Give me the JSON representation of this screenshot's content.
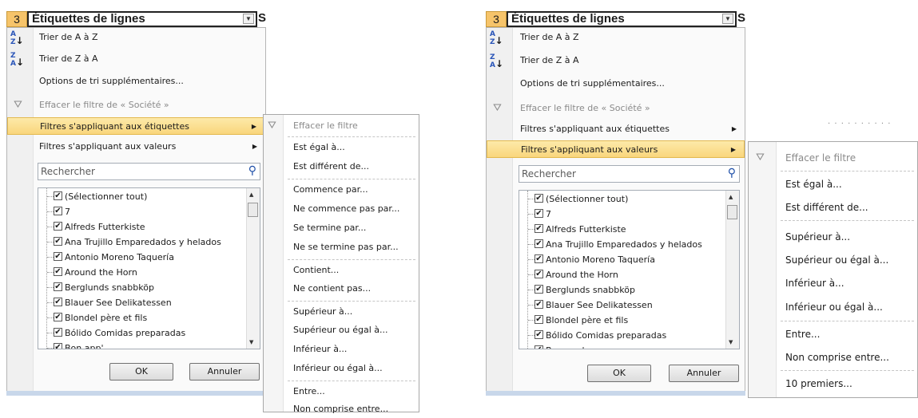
{
  "header": {
    "row_number": "3",
    "title": "Étiquettes de lignes",
    "right_char": "S"
  },
  "menu": {
    "sort_asc": "Trier de A à Z",
    "sort_desc": "Trier de Z à A",
    "more_sort": "Options de tri supplémentaires...",
    "clear_filter": "Effacer le filtre de « Société »",
    "label_filters": "Filtres s'appliquant aux étiquettes",
    "value_filters": "Filtres s'appliquant aux valeurs"
  },
  "search": {
    "placeholder": "Rechercher"
  },
  "list_items": [
    "(Sélectionner tout)",
    "7",
    "Alfreds Futterkiste",
    "Ana Trujillo Emparedados y helados",
    "Antonio Moreno Taquería",
    "Around the Horn",
    "Berglunds snabbköp",
    "Blauer See Delikatessen",
    "Blondel père et fils",
    "Bólido Comidas preparadas",
    "Bon app'"
  ],
  "buttons": {
    "ok": "OK",
    "cancel": "Annuler"
  },
  "label_submenu": [
    "Effacer le filtre",
    "Est égal à...",
    "Est différent de...",
    "Commence par...",
    "Ne commence pas par...",
    "Se termine par...",
    "Ne se termine pas par...",
    "Contient...",
    "Ne contient pas...",
    "Supérieur à...",
    "Supérieur ou égal à...",
    "Inférieur à...",
    "Inférieur ou égal à...",
    "Entre...",
    "Non comprise entre..."
  ],
  "value_submenu": [
    "Effacer le filtre",
    "Est égal à...",
    "Est différent de...",
    "Supérieur à...",
    "Supérieur ou égal à...",
    "Inférieur à...",
    "Inférieur ou égal à...",
    "Entre...",
    "Non comprise entre...",
    "10 premiers..."
  ],
  "icons": {
    "sort_asc": "sort-a-z-icon",
    "sort_desc": "sort-z-a-icon",
    "clear": "clear-filter-funnel-icon",
    "search": "magnifier-icon",
    "submenu": "triangle-right-icon"
  },
  "colors": {
    "highlight_top": "#fdeaa9",
    "highlight_bottom": "#f9d67c",
    "row_header": "#f6c46a",
    "link_blue": "#1e4fa8"
  }
}
